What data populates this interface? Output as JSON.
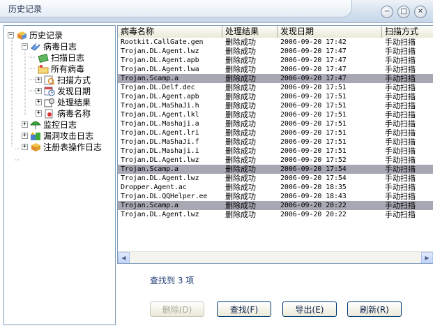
{
  "window": {
    "title": "历史记录",
    "controls": {
      "minimize": "−",
      "maximize": "□",
      "close": "✕"
    }
  },
  "tree": {
    "items": [
      {
        "label": "历史记录",
        "icon": "history-cube-icon",
        "expander": "−"
      },
      {
        "label": "病毒日志",
        "icon": "virus-log-icon",
        "expander": "−"
      },
      {
        "label": "扫描日志",
        "icon": "scan-log-icon",
        "expander": ""
      },
      {
        "label": "所有病毒",
        "icon": "all-viruses-icon",
        "expander": ""
      },
      {
        "label": "扫描方式",
        "icon": "scan-method-icon",
        "expander": "+"
      },
      {
        "label": "发现日期",
        "icon": "calendar-clock-icon",
        "expander": "+"
      },
      {
        "label": "处理结果",
        "icon": "process-result-icon",
        "expander": "+"
      },
      {
        "label": "病毒名称",
        "icon": "virus-name-icon",
        "expander": "+"
      },
      {
        "label": "监控日志",
        "icon": "monitor-umbrella-icon",
        "expander": "+"
      },
      {
        "label": "漏洞攻击日志",
        "icon": "exploit-attack-icon",
        "expander": "+"
      },
      {
        "label": "注册表操作日志",
        "icon": "registry-cube-icon",
        "expander": "+"
      }
    ]
  },
  "table": {
    "columns": [
      "病毒名称",
      "处理结果",
      "发现日期",
      "扫描方式"
    ],
    "rows": [
      {
        "name": "Rootkit.CallGate.gen",
        "result": "删除成功",
        "date": "2006-09-20 17:42",
        "method": "手动扫描",
        "highlight": false
      },
      {
        "name": "Trojan.DL.Agent.lwz",
        "result": "删除成功",
        "date": "2006-09-20 17:47",
        "method": "手动扫描",
        "highlight": false
      },
      {
        "name": "Trojan.DL.Agent.apb",
        "result": "删除成功",
        "date": "2006-09-20 17:47",
        "method": "手动扫描",
        "highlight": false
      },
      {
        "name": "Trojan.DL.Agent.lwa",
        "result": "删除成功",
        "date": "2006-09-20 17:47",
        "method": "手动扫描",
        "highlight": false
      },
      {
        "name": "Trojan.Scamp.a",
        "result": "删除成功",
        "date": "2006-09-20 17:47",
        "method": "手动扫描",
        "highlight": true
      },
      {
        "name": "Trojan.DL.Delf.dec",
        "result": "删除成功",
        "date": "2006-09-20 17:51",
        "method": "手动扫描",
        "highlight": false
      },
      {
        "name": "Trojan.DL.Agent.apb",
        "result": "删除成功",
        "date": "2006-09-20 17:51",
        "method": "手动扫描",
        "highlight": false
      },
      {
        "name": "Trojan.DL.MaShaJi.h",
        "result": "删除成功",
        "date": "2006-09-20 17:51",
        "method": "手动扫描",
        "highlight": false
      },
      {
        "name": "Trojan.DL.Agent.lkl",
        "result": "删除成功",
        "date": "2006-09-20 17:51",
        "method": "手动扫描",
        "highlight": false
      },
      {
        "name": "Trojan.DL.Mashaji.a",
        "result": "删除成功",
        "date": "2006-09-20 17:51",
        "method": "手动扫描",
        "highlight": false
      },
      {
        "name": "Trojan.DL.Agent.lri",
        "result": "删除成功",
        "date": "2006-09-20 17:51",
        "method": "手动扫描",
        "highlight": false
      },
      {
        "name": "Trojan.DL.MaShaJi.f",
        "result": "删除成功",
        "date": "2006-09-20 17:51",
        "method": "手动扫描",
        "highlight": false
      },
      {
        "name": "Trojan.DL.Mashaji.i",
        "result": "删除成功",
        "date": "2006-09-20 17:51",
        "method": "手动扫描",
        "highlight": false
      },
      {
        "name": "Trojan.DL.Agent.lwz",
        "result": "删除成功",
        "date": "2006-09-20 17:52",
        "method": "手动扫描",
        "highlight": false
      },
      {
        "name": "Trojan.Scamp.a",
        "result": "删除成功",
        "date": "2006-09-20 17:54",
        "method": "手动扫描",
        "highlight": true
      },
      {
        "name": "Trojan.DL.Agent.lwz",
        "result": "删除成功",
        "date": "2006-09-20 17:54",
        "method": "手动扫描",
        "highlight": false
      },
      {
        "name": "Dropper.Agent.ac",
        "result": "删除成功",
        "date": "2006-09-20 18:35",
        "method": "手动扫描",
        "highlight": false
      },
      {
        "name": "Trojan.DL.QQHelper.ee",
        "result": "删除成功",
        "date": "2006-09-20 18:43",
        "method": "手动扫描",
        "highlight": false
      },
      {
        "name": "Trojan.Scamp.a",
        "result": "删除成功",
        "date": "2006-09-20 20:22",
        "method": "手动扫描",
        "highlight": true
      },
      {
        "name": "Trojan.DL.Agent.lwz",
        "result": "删除成功",
        "date": "2006-09-20 20:22",
        "method": "手动扫描",
        "highlight": false
      }
    ],
    "highlight_color": "#a8a8b4"
  },
  "status": {
    "found_text": "查找到 3 项"
  },
  "buttons": {
    "delete": "删除(D)",
    "find": "查找(F)",
    "export": "导出(E)",
    "refresh": "刷新(R)"
  },
  "scrollbar": {
    "left_arrow": "◀",
    "right_arrow": "▶"
  }
}
